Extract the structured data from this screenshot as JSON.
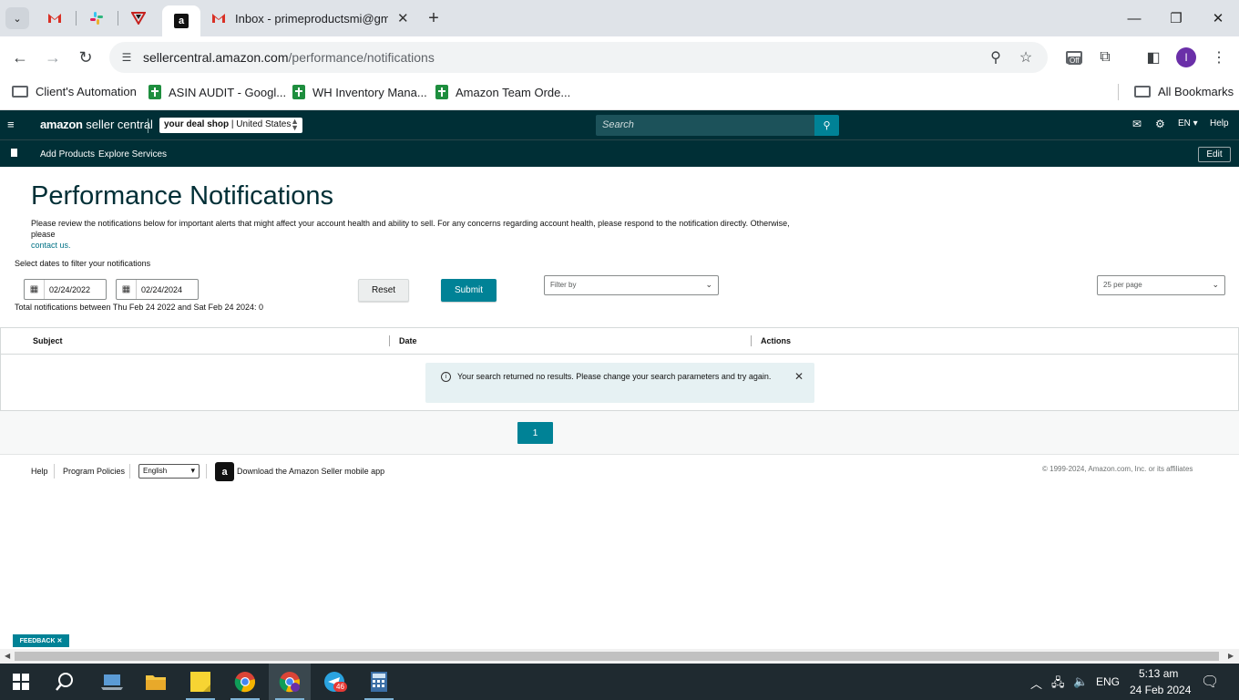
{
  "browser": {
    "tabs": {
      "gmail_title": "Inbox - primeproductsmi@gmail.com",
      "close_symbol": "✕",
      "new_tab_symbol": "+"
    },
    "window_controls": {
      "minimize": "—",
      "restore": "❐",
      "close": "✕"
    },
    "url": {
      "domain": "sellercentral.amazon.com",
      "path": "/performance/notifications"
    },
    "extension_badge": "Off",
    "profile_initial": "I",
    "bookmarks": [
      {
        "label": "Client's Automation",
        "icon": "folder-icon"
      },
      {
        "label": "ASIN AUDIT - Googl...",
        "icon": "sheets-icon"
      },
      {
        "label": "WH Inventory Mana...",
        "icon": "sheets-icon"
      },
      {
        "label": "Amazon Team Orde...",
        "icon": "sheets-icon"
      }
    ],
    "all_bookmarks": "All Bookmarks"
  },
  "seller_central": {
    "logo_brand": "amazon",
    "logo_product": "seller central",
    "store": {
      "name": "your deal shop",
      "marketplace": "United States"
    },
    "search_placeholder": "Search",
    "language": "EN",
    "help": "Help",
    "nav_links": [
      "Add Products",
      "Explore Services"
    ],
    "edit": "Edit"
  },
  "page": {
    "title": "Performance Notifications",
    "description": "Please review the notifications below for important alerts that might affect your account health and ability to sell. For any concerns regarding account health, please respond to the notification directly. Otherwise, please",
    "contact_link": "contact us.",
    "filter_label": "Select dates to filter your notifications",
    "date_from": "02/24/2022",
    "date_to": "02/24/2024",
    "reset": "Reset",
    "submit": "Submit",
    "filter_by": "Filter by",
    "per_page": "25 per page",
    "total_line": "Total notifications between Thu Feb 24 2022 and Sat Feb 24 2024: 0",
    "columns": [
      "Subject",
      "Date",
      "Actions"
    ],
    "alert_message": "Your search returned no results. Please change your search parameters and try again.",
    "current_page": "1"
  },
  "footer": {
    "help": "Help",
    "program_policies": "Program Policies",
    "language_select": "English",
    "app_text": "Download the Amazon Seller mobile app",
    "copyright": "© 1999-2024, Amazon.com, Inc. or its affiliates"
  },
  "feedback": "FEEDBACK ✕",
  "taskbar": {
    "telegram_badge": "46",
    "lang": "ENG",
    "time": "5:13 am",
    "date": "24 Feb 2024"
  },
  "colors": {
    "header_bg": "#002f36",
    "accent_teal": "#008296",
    "alert_bg": "#e6f1f3"
  }
}
